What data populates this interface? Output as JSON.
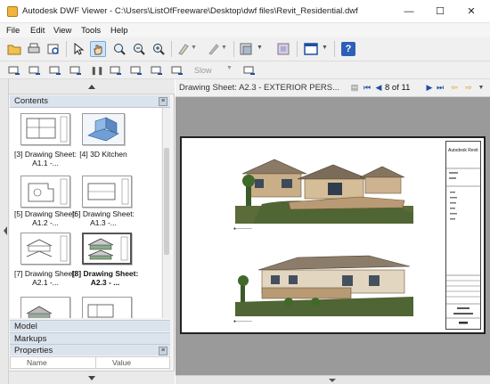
{
  "window": {
    "title": "Autodesk DWF Viewer - C:\\Users\\ListOfFreeware\\Desktop\\dwf files\\Revit_Residential.dwf",
    "controls": {
      "minimize": "—",
      "maximize": "☐",
      "close": "✕"
    }
  },
  "menu": {
    "file": "File",
    "edit": "Edit",
    "view": "View",
    "tools": "Tools",
    "help": "Help"
  },
  "toolbar2": {
    "speed_label": "Slow"
  },
  "panel": {
    "contents_title": "Contents",
    "thumbnails": [
      {
        "caption": "[3] Drawing Sheet: A1.1 -...",
        "kind": "plan",
        "selected": false
      },
      {
        "caption": "[4] 3D Kitchen",
        "kind": "kitchen3d",
        "selected": false
      },
      {
        "caption": "[5] Drawing Sheet: A1.2 -...",
        "kind": "plan",
        "selected": false
      },
      {
        "caption": "[6] Drawing Sheet: A1.3 -...",
        "kind": "plan",
        "selected": false
      },
      {
        "caption": "[7] Drawing Sheet: A2.1 -...",
        "kind": "elevation",
        "selected": false
      },
      {
        "caption": "[8] Drawing Sheet: A2.3 - ...",
        "kind": "elevation",
        "selected": true
      },
      {
        "caption": "",
        "kind": "render",
        "selected": false
      },
      {
        "caption": "",
        "kind": "render",
        "selected": false
      }
    ],
    "model_label": "Model",
    "markups_label": "Markups",
    "properties_label": "Properties",
    "properties_columns": {
      "name": "Name",
      "value": "Value"
    }
  },
  "viewer": {
    "sheet_title": "Drawing Sheet: A2.3 - EXTERIOR PERS...",
    "page_label": "8 of 11",
    "titleblock_name": "Autodesk Revit",
    "colors": {
      "canvas": "#9a9a9a",
      "nav_icon": "#1f4fa0"
    }
  }
}
